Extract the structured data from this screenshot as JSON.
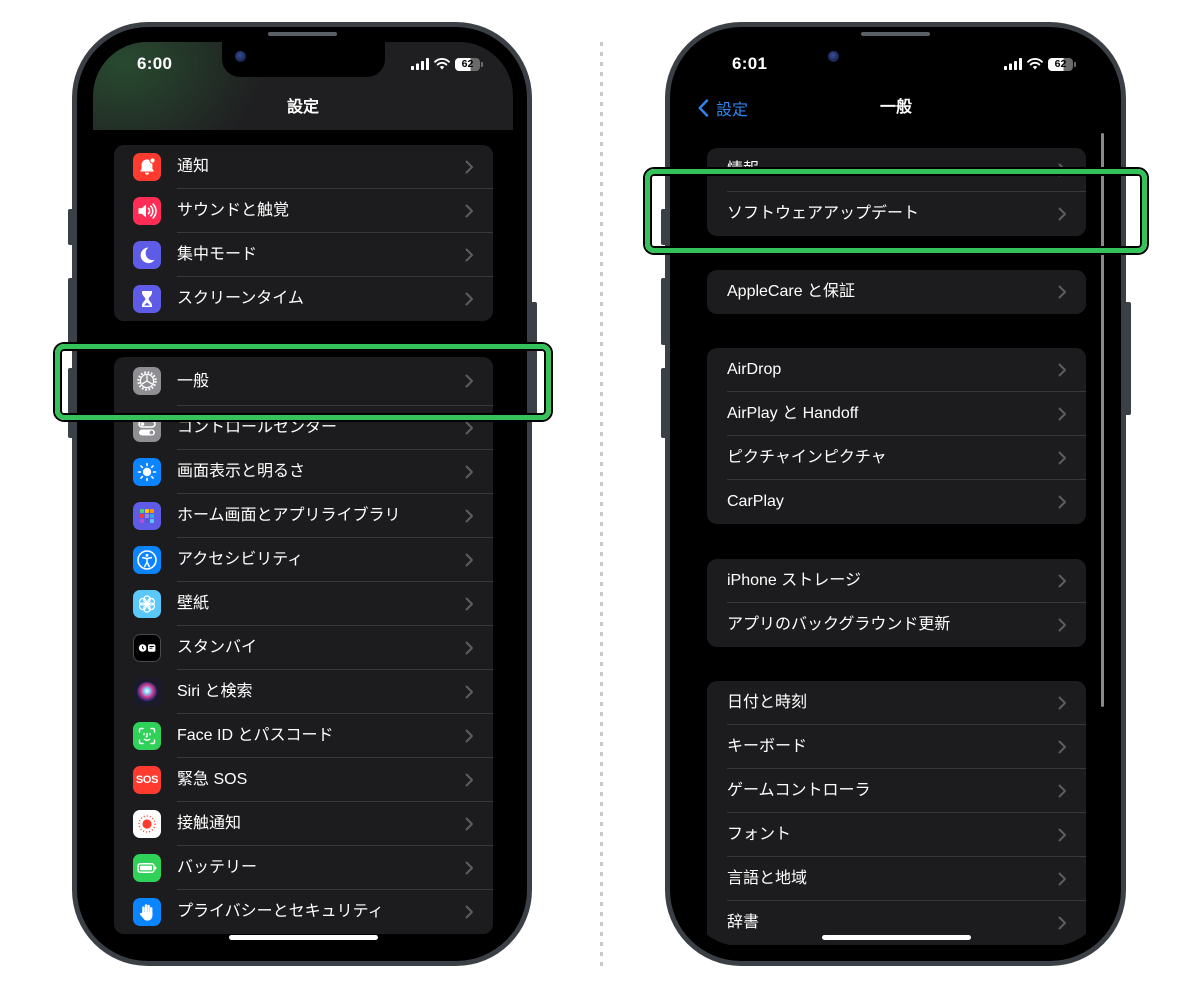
{
  "left": {
    "status_bar": {
      "time": "6:00",
      "battery_level": "62"
    },
    "nav_title": "設定",
    "groups": [
      {
        "items": [
          {
            "label": "通知",
            "icon": "bell",
            "icon_color": "#ff3b30"
          },
          {
            "label": "サウンドと触覚",
            "icon": "speaker",
            "icon_color": "#ff2d55"
          },
          {
            "label": "集中モード",
            "icon": "moon",
            "icon_color": "#5e5ce6"
          },
          {
            "label": "スクリーンタイム",
            "icon": "hourglass",
            "icon_color": "#5e5ce6"
          }
        ]
      },
      {
        "items": [
          {
            "label": "一般",
            "icon": "gear",
            "icon_color": "#8e8e93"
          },
          {
            "label": "コントロールセンター",
            "icon": "toggles",
            "icon_color": "#8e8e93"
          },
          {
            "label": "画面表示と明るさ",
            "icon": "sun",
            "icon_color": "#0a84ff"
          },
          {
            "label": "ホーム画面とアプリライブラリ",
            "icon": "app-grid",
            "icon_color": "#5e5ce6"
          },
          {
            "label": "アクセシビリティ",
            "icon": "accessibility",
            "icon_color": "#0a84ff"
          },
          {
            "label": "壁紙",
            "icon": "flower",
            "icon_color": "#5ac8fa"
          },
          {
            "label": "スタンバイ",
            "icon": "standby",
            "icon_color": "#000000"
          },
          {
            "label": "Siri と検索",
            "icon": "siri",
            "icon_color": "#1a1a2a"
          },
          {
            "label": "Face ID とパスコード",
            "icon": "face-id",
            "icon_color": "#30d158"
          },
          {
            "label": "緊急 SOS",
            "icon": "sos",
            "icon_color": "#ff3b30",
            "icon_text": "SOS"
          },
          {
            "label": "接触通知",
            "icon": "exposure",
            "icon_color": "#ffffff"
          },
          {
            "label": "バッテリー",
            "icon": "battery",
            "icon_color": "#30d158"
          },
          {
            "label": "プライバシーとセキュリティ",
            "icon": "hand",
            "icon_color": "#0a84ff"
          }
        ]
      }
    ],
    "highlighted_item": "一般"
  },
  "right": {
    "status_bar": {
      "time": "6:01",
      "battery_level": "62"
    },
    "nav_back_label": "設定",
    "nav_title": "一般",
    "groups": [
      {
        "items": [
          {
            "label": "情報"
          },
          {
            "label": "ソフトウェアアップデート"
          }
        ]
      },
      {
        "items": [
          {
            "label": "AppleCare と保証"
          }
        ]
      },
      {
        "items": [
          {
            "label": "AirDrop"
          },
          {
            "label": "AirPlay と Handoff"
          },
          {
            "label": "ピクチャインピクチャ"
          },
          {
            "label": "CarPlay"
          }
        ]
      },
      {
        "items": [
          {
            "label": "iPhone ストレージ"
          },
          {
            "label": "アプリのバックグラウンド更新"
          }
        ]
      },
      {
        "items": [
          {
            "label": "日付と時刻"
          },
          {
            "label": "キーボード"
          },
          {
            "label": "ゲームコントローラ"
          },
          {
            "label": "フォント"
          },
          {
            "label": "言語と地域"
          },
          {
            "label": "辞書"
          }
        ]
      }
    ],
    "highlighted_item": "ソフトウェアアップデート"
  },
  "colors": {
    "highlight": "#36c25a",
    "link_blue": "#2f86f0",
    "group_bg": "#1c1c1e"
  }
}
